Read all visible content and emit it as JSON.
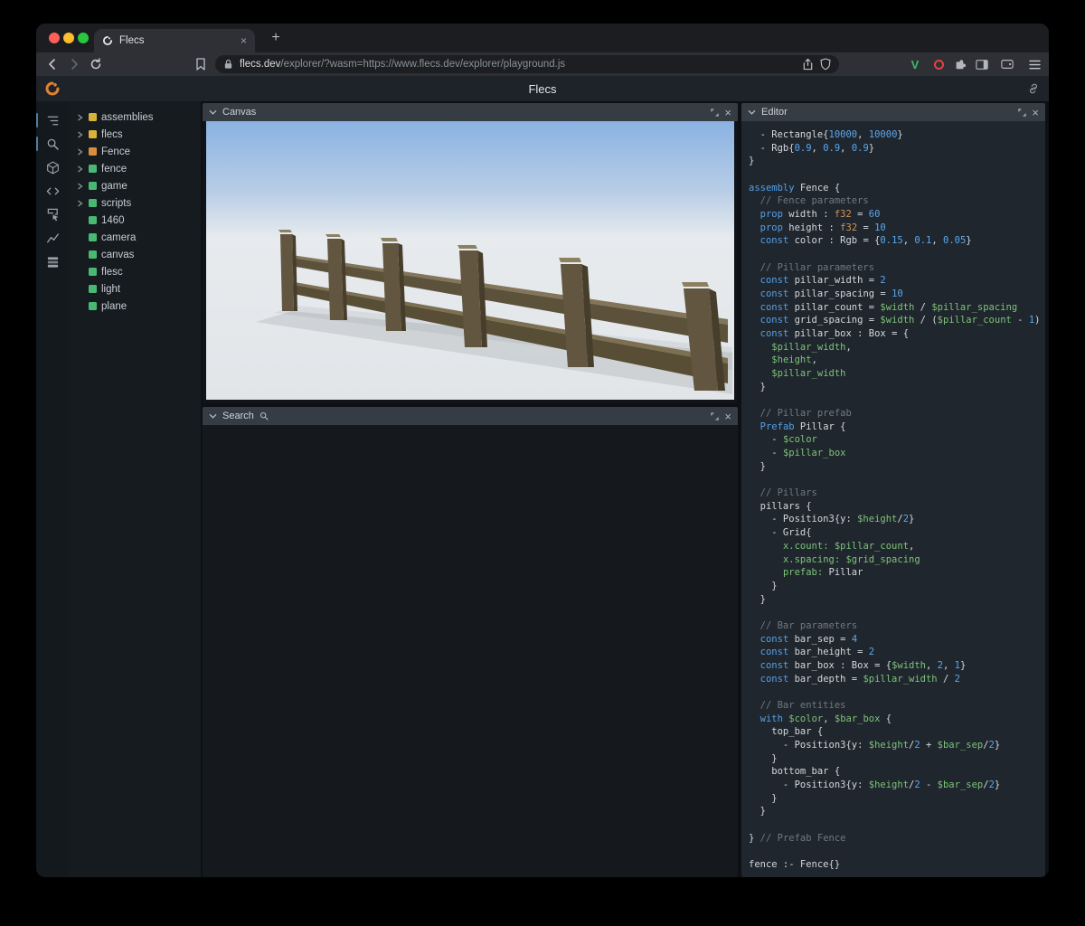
{
  "browser": {
    "tab_title": "Flecs",
    "close_tab_label": "×",
    "new_tab_label": "+",
    "url_host": "flecs.dev",
    "url_rest": "/explorer/?wasm=https://www.flecs.dev/explorer/playground.js",
    "traffic_lights": {
      "close": "#ff5f57",
      "minimize": "#febc2e",
      "zoom": "#28c840"
    },
    "extension_v_label": "V"
  },
  "header": {
    "title": "Flecs"
  },
  "activity_bar": {
    "icons": [
      "hierarchy",
      "search",
      "cube",
      "code",
      "inspect",
      "stats",
      "list"
    ]
  },
  "sidebar": {
    "items": [
      {
        "label": "assemblies",
        "color": "#d9b13b",
        "expand": true
      },
      {
        "label": "flecs",
        "color": "#d9b13b",
        "expand": true
      },
      {
        "label": "Fence",
        "color": "#d98e3b",
        "expand": true
      },
      {
        "label": "fence",
        "color": "#48b873",
        "expand": true
      },
      {
        "label": "game",
        "color": "#48b873",
        "expand": true
      },
      {
        "label": "scripts",
        "color": "#48b873",
        "expand": true
      },
      {
        "label": "1460",
        "color": "#48b873",
        "expand": false
      },
      {
        "label": "camera",
        "color": "#48b873",
        "expand": false
      },
      {
        "label": "canvas",
        "color": "#48b873",
        "expand": false
      },
      {
        "label": "flesc",
        "color": "#48b873",
        "expand": false
      },
      {
        "label": "light",
        "color": "#48b873",
        "expand": false
      },
      {
        "label": "plane",
        "color": "#48b873",
        "expand": false
      }
    ]
  },
  "panels": {
    "canvas": {
      "title": "Canvas"
    },
    "search": {
      "title": "Search"
    },
    "editor": {
      "title": "Editor"
    }
  },
  "editor": {
    "lines": [
      [
        [
          "p",
          "  - Rectangle{"
        ],
        [
          "n",
          "10000"
        ],
        [
          "p",
          ", "
        ],
        [
          "n",
          "10000"
        ],
        [
          "p",
          "}"
        ]
      ],
      [
        [
          "p",
          "  - Rgb{"
        ],
        [
          "n",
          "0.9"
        ],
        [
          "p",
          ", "
        ],
        [
          "n",
          "0.9"
        ],
        [
          "p",
          ", "
        ],
        [
          "n",
          "0.9"
        ],
        [
          "p",
          "}"
        ]
      ],
      [
        [
          "p",
          "}"
        ]
      ],
      [],
      [
        [
          "k",
          "assembly"
        ],
        [
          "p",
          " Fence {"
        ]
      ],
      [
        [
          "c",
          "  // Fence parameters"
        ]
      ],
      [
        [
          "p",
          "  "
        ],
        [
          "k",
          "prop"
        ],
        [
          "p",
          " width : "
        ],
        [
          "t",
          "f32"
        ],
        [
          "p",
          " = "
        ],
        [
          "n",
          "60"
        ]
      ],
      [
        [
          "p",
          "  "
        ],
        [
          "k",
          "prop"
        ],
        [
          "p",
          " height : "
        ],
        [
          "t",
          "f32"
        ],
        [
          "p",
          " = "
        ],
        [
          "n",
          "10"
        ]
      ],
      [
        [
          "p",
          "  "
        ],
        [
          "k",
          "const"
        ],
        [
          "p",
          " color : Rgb = {"
        ],
        [
          "n",
          "0.15"
        ],
        [
          "p",
          ", "
        ],
        [
          "n",
          "0.1"
        ],
        [
          "p",
          ", "
        ],
        [
          "n",
          "0.05"
        ],
        [
          "p",
          "}"
        ]
      ],
      [],
      [
        [
          "c",
          "  // Pillar parameters"
        ]
      ],
      [
        [
          "p",
          "  "
        ],
        [
          "k",
          "const"
        ],
        [
          "p",
          " pillar_width = "
        ],
        [
          "n",
          "2"
        ]
      ],
      [
        [
          "p",
          "  "
        ],
        [
          "k",
          "const"
        ],
        [
          "p",
          " pillar_spacing = "
        ],
        [
          "n",
          "10"
        ]
      ],
      [
        [
          "p",
          "  "
        ],
        [
          "k",
          "const"
        ],
        [
          "p",
          " pillar_count = "
        ],
        [
          "v",
          "$width"
        ],
        [
          "p",
          " / "
        ],
        [
          "v",
          "$pillar_spacing"
        ]
      ],
      [
        [
          "p",
          "  "
        ],
        [
          "k",
          "const"
        ],
        [
          "p",
          " grid_spacing = "
        ],
        [
          "v",
          "$width"
        ],
        [
          "p",
          " / ("
        ],
        [
          "v",
          "$pillar_count"
        ],
        [
          "p",
          " - "
        ],
        [
          "n",
          "1"
        ],
        [
          "p",
          ")"
        ]
      ],
      [
        [
          "p",
          "  "
        ],
        [
          "k",
          "const"
        ],
        [
          "p",
          " pillar_box : Box = {"
        ]
      ],
      [
        [
          "p",
          "    "
        ],
        [
          "v",
          "$pillar_width"
        ],
        [
          "p",
          ","
        ]
      ],
      [
        [
          "p",
          "    "
        ],
        [
          "v",
          "$height"
        ],
        [
          "p",
          ","
        ]
      ],
      [
        [
          "p",
          "    "
        ],
        [
          "v",
          "$pillar_width"
        ]
      ],
      [
        [
          "p",
          "  }"
        ]
      ],
      [],
      [
        [
          "c",
          "  // Pillar prefab"
        ]
      ],
      [
        [
          "p",
          "  "
        ],
        [
          "k",
          "Prefab"
        ],
        [
          "p",
          " Pillar {"
        ]
      ],
      [
        [
          "p",
          "    - "
        ],
        [
          "v",
          "$color"
        ]
      ],
      [
        [
          "p",
          "    - "
        ],
        [
          "v",
          "$pillar_box"
        ]
      ],
      [
        [
          "p",
          "  }"
        ]
      ],
      [],
      [
        [
          "c",
          "  // Pillars"
        ]
      ],
      [
        [
          "p",
          "  pillars {"
        ]
      ],
      [
        [
          "p",
          "    - Position3{y: "
        ],
        [
          "v",
          "$height"
        ],
        [
          "p",
          "/"
        ],
        [
          "n",
          "2"
        ],
        [
          "p",
          "}"
        ]
      ],
      [
        [
          "p",
          "    - Grid{"
        ]
      ],
      [
        [
          "p",
          "      "
        ],
        [
          "key",
          "x.count:"
        ],
        [
          "p",
          " "
        ],
        [
          "v",
          "$pillar_count"
        ],
        [
          "p",
          ","
        ]
      ],
      [
        [
          "p",
          "      "
        ],
        [
          "key",
          "x.spacing:"
        ],
        [
          "p",
          " "
        ],
        [
          "v",
          "$grid_spacing"
        ]
      ],
      [
        [
          "p",
          "      "
        ],
        [
          "key",
          "prefab:"
        ],
        [
          "p",
          " Pillar"
        ]
      ],
      [
        [
          "p",
          "    }"
        ]
      ],
      [
        [
          "p",
          "  }"
        ]
      ],
      [],
      [
        [
          "c",
          "  // Bar parameters"
        ]
      ],
      [
        [
          "p",
          "  "
        ],
        [
          "k",
          "const"
        ],
        [
          "p",
          " bar_sep = "
        ],
        [
          "n",
          "4"
        ]
      ],
      [
        [
          "p",
          "  "
        ],
        [
          "k",
          "const"
        ],
        [
          "p",
          " bar_height = "
        ],
        [
          "n",
          "2"
        ]
      ],
      [
        [
          "p",
          "  "
        ],
        [
          "k",
          "const"
        ],
        [
          "p",
          " bar_box : Box = {"
        ],
        [
          "v",
          "$width"
        ],
        [
          "p",
          ", "
        ],
        [
          "n",
          "2"
        ],
        [
          "p",
          ", "
        ],
        [
          "n",
          "1"
        ],
        [
          "p",
          "}"
        ]
      ],
      [
        [
          "p",
          "  "
        ],
        [
          "k",
          "const"
        ],
        [
          "p",
          " bar_depth = "
        ],
        [
          "v",
          "$pillar_width"
        ],
        [
          "p",
          " / "
        ],
        [
          "n",
          "2"
        ]
      ],
      [],
      [
        [
          "c",
          "  // Bar entities"
        ]
      ],
      [
        [
          "p",
          "  "
        ],
        [
          "k",
          "with"
        ],
        [
          "p",
          " "
        ],
        [
          "v",
          "$color"
        ],
        [
          "p",
          ", "
        ],
        [
          "v",
          "$bar_box"
        ],
        [
          "p",
          " {"
        ]
      ],
      [
        [
          "p",
          "    top_bar {"
        ]
      ],
      [
        [
          "p",
          "      - Position3{y: "
        ],
        [
          "v",
          "$height"
        ],
        [
          "p",
          "/"
        ],
        [
          "n",
          "2"
        ],
        [
          "p",
          " + "
        ],
        [
          "v",
          "$bar_sep"
        ],
        [
          "p",
          "/"
        ],
        [
          "n",
          "2"
        ],
        [
          "p",
          "}"
        ]
      ],
      [
        [
          "p",
          "    }"
        ]
      ],
      [
        [
          "p",
          "    bottom_bar {"
        ]
      ],
      [
        [
          "p",
          "      - Position3{y: "
        ],
        [
          "v",
          "$height"
        ],
        [
          "p",
          "/"
        ],
        [
          "n",
          "2"
        ],
        [
          "p",
          " - "
        ],
        [
          "v",
          "$bar_sep"
        ],
        [
          "p",
          "/"
        ],
        [
          "n",
          "2"
        ],
        [
          "p",
          "}"
        ]
      ],
      [
        [
          "p",
          "    }"
        ]
      ],
      [
        [
          "p",
          "  }"
        ]
      ],
      [],
      [
        [
          "p",
          "} "
        ],
        [
          "c",
          "// Prefab Fence"
        ]
      ],
      [],
      [
        [
          "p",
          "fence :- Fence{}"
        ]
      ]
    ]
  }
}
